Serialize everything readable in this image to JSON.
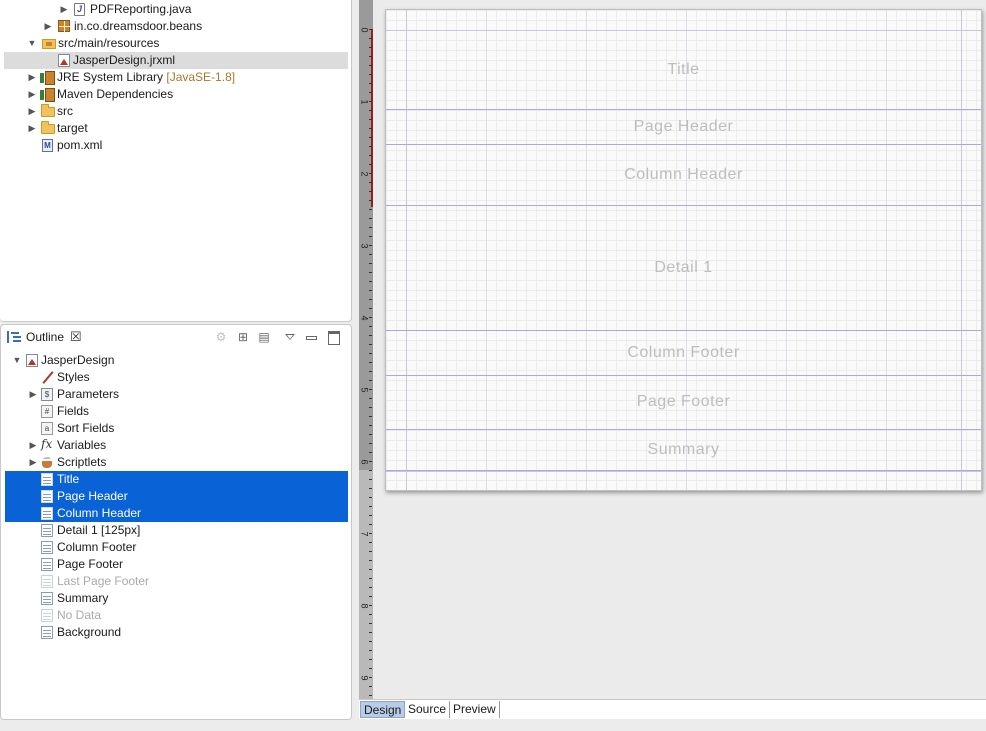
{
  "project_tree": {
    "items": [
      {
        "label": "PDFReporting.java",
        "deco": "",
        "icon": "java-file-icon",
        "expanded": false
      },
      {
        "label": "in.co.dreamsdoor.beans",
        "deco": "",
        "icon": "package-icon",
        "expanded": false
      },
      {
        "label": "src/main/resources",
        "deco": "",
        "icon": "source-folder-icon",
        "expanded": true
      },
      {
        "label": "JasperDesign.jrxml",
        "deco": "",
        "icon": "jrxml-file-icon",
        "selected": true
      },
      {
        "label": "JRE System Library",
        "deco": "[JavaSE-1.8]",
        "icon": "library-icon",
        "expanded": false
      },
      {
        "label": "Maven Dependencies",
        "deco": "",
        "icon": "library-icon",
        "expanded": false
      },
      {
        "label": "src",
        "deco": "",
        "icon": "folder-icon",
        "expanded": false
      },
      {
        "label": "target",
        "deco": "",
        "icon": "folder-icon",
        "expanded": false
      },
      {
        "label": "pom.xml",
        "deco": "",
        "icon": "maven-pom-icon"
      }
    ]
  },
  "outline": {
    "tab_label": "Outline",
    "close_glyph": "☒",
    "root_label": "JasperDesign",
    "items": [
      {
        "label": "Styles",
        "icon": "styles-icon"
      },
      {
        "label": "Parameters",
        "icon": "parameters-icon",
        "expandable": true
      },
      {
        "label": "Fields",
        "icon": "fields-icon"
      },
      {
        "label": "Sort Fields",
        "icon": "sort-fields-icon"
      },
      {
        "label": "Variables",
        "icon": "variables-icon",
        "expandable": true
      },
      {
        "label": "Scriptlets",
        "icon": "scriptlets-icon",
        "expandable": true
      },
      {
        "label": "Title",
        "icon": "band-icon",
        "selected": true
      },
      {
        "label": "Page Header",
        "icon": "band-icon",
        "selected": true
      },
      {
        "label": "Column Header",
        "icon": "band-icon",
        "selected": true
      },
      {
        "label": "Detail 1 [125px]",
        "icon": "band-icon"
      },
      {
        "label": "Column Footer",
        "icon": "band-icon"
      },
      {
        "label": "Page Footer",
        "icon": "band-icon"
      },
      {
        "label": "Last Page Footer",
        "icon": "band-icon",
        "disabled": true
      },
      {
        "label": "Summary",
        "icon": "band-icon"
      },
      {
        "label": "No Data",
        "icon": "band-icon",
        "disabled": true
      },
      {
        "label": "Background",
        "icon": "band-icon"
      }
    ]
  },
  "designer": {
    "ruler_numbers": [
      "0",
      "1",
      "2",
      "3",
      "4",
      "5",
      "6",
      "7",
      "8",
      "9"
    ],
    "bands": [
      {
        "label": "Title"
      },
      {
        "label": "Page Header"
      },
      {
        "label": "Column Header"
      },
      {
        "label": "Detail 1"
      },
      {
        "label": "Column Footer"
      },
      {
        "label": "Page Footer"
      },
      {
        "label": "Summary"
      }
    ]
  },
  "editor_tabs": {
    "design": "Design",
    "source": "Source",
    "preview": "Preview",
    "active": "Design"
  },
  "colors": {
    "selection_blue": "#0a63d6",
    "band_line": "#a9a9e0",
    "ruler_marker": "#9b1d1d"
  }
}
